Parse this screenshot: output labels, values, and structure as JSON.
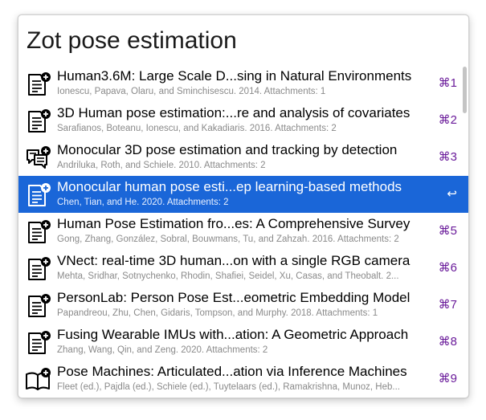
{
  "search": {
    "query": "Zot pose estimation"
  },
  "results": [
    {
      "title": "Human3.6M: Large Scale D...sing in Natural Environments",
      "subtitle": "Ionescu, Papava, Olaru, and Sminchisescu. 2014. Attachments: 1",
      "shortcut": "⌘1",
      "icon": "document-add-icon",
      "selected": false
    },
    {
      "title": "3D Human pose estimation:...re and analysis of covariates",
      "subtitle": "Sarafianos, Boteanu, Ionescu, and Kakadiaris. 2016. Attachments: 2",
      "shortcut": "⌘2",
      "icon": "document-add-icon",
      "selected": false
    },
    {
      "title": "Monocular 3D pose estimation and tracking by detection",
      "subtitle": "Andriluka, Roth, and Schiele. 2010. Attachments: 2",
      "shortcut": "⌘3",
      "icon": "conference-paper-icon",
      "selected": false
    },
    {
      "title": "Monocular human pose esti...ep learning-based methods",
      "subtitle": "Chen, Tian, and He. 2020. Attachments: 2",
      "shortcut": "↩",
      "icon": "document-add-icon",
      "selected": true
    },
    {
      "title": "Human Pose Estimation fro...es: A Comprehensive Survey",
      "subtitle": "Gong, Zhang, González, Sobral, Bouwmans, Tu, and Zahzah. 2016. Attachments: 2",
      "shortcut": "⌘5",
      "icon": "document-add-icon",
      "selected": false
    },
    {
      "title": "VNect: real-time 3D human...on with a single RGB camera",
      "subtitle": "Mehta, Sridhar, Sotnychenko, Rhodin, Shafiei, Seidel, Xu, Casas, and Theobalt. 2...",
      "shortcut": "⌘6",
      "icon": "document-add-icon",
      "selected": false
    },
    {
      "title": "PersonLab: Person Pose Est...eometric Embedding Model",
      "subtitle": "Papandreou, Zhu, Chen, Gidaris, Tompson, and Murphy. 2018. Attachments: 1",
      "shortcut": "⌘7",
      "icon": "document-add-icon",
      "selected": false
    },
    {
      "title": "Fusing Wearable IMUs with...ation: A Geometric Approach",
      "subtitle": "Zhang, Wang, Qin, and Zeng. 2020. Attachments: 2",
      "shortcut": "⌘8",
      "icon": "document-add-icon",
      "selected": false
    },
    {
      "title": "Pose Machines: Articulated...ation via Inference Machines",
      "subtitle": "Fleet (ed.), Pajdla (ed.), Schiele (ed.), Tuytelaars (ed.), Ramakrishna, Munoz, Heb...",
      "shortcut": "⌘9",
      "icon": "book-add-icon",
      "selected": false
    }
  ],
  "colors": {
    "selection": "#1a66d8",
    "shortcut": "#6a1b9a",
    "subtitle": "#8a8a8a"
  }
}
